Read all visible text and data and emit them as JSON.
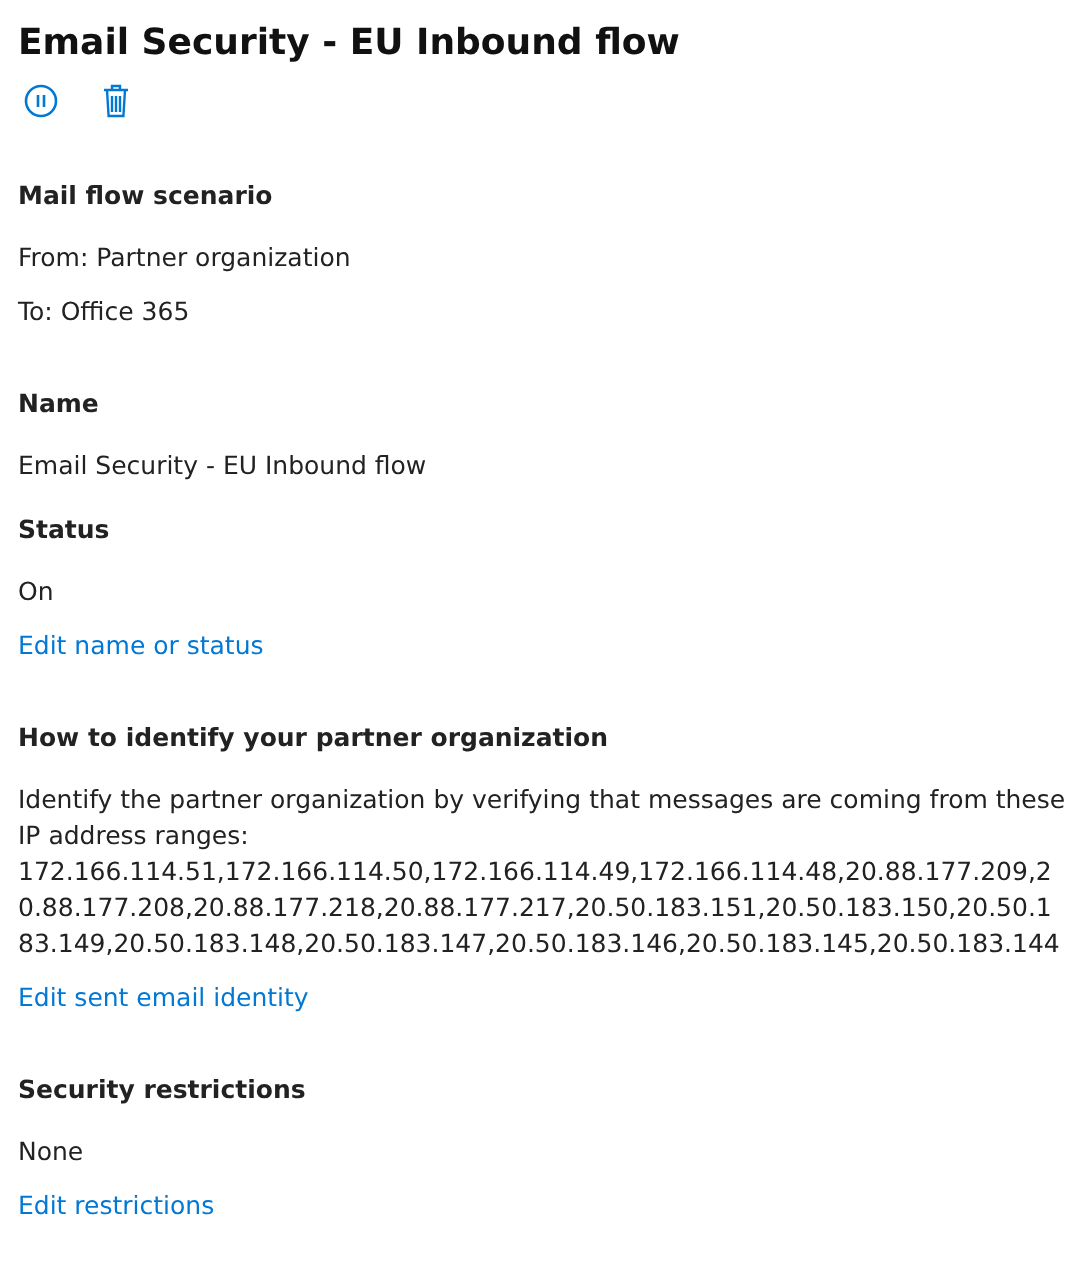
{
  "title": "Email Security - EU Inbound flow",
  "actions": [
    {
      "kind": "pause"
    },
    {
      "kind": "delete"
    }
  ],
  "groups": [
    {
      "sections": [
        {
          "heading": "Mail flow scenario",
          "lines": [
            {
              "kind": "text",
              "text": "From: Partner organization"
            },
            {
              "kind": "text",
              "text": "To: Office 365"
            }
          ]
        }
      ]
    },
    {
      "sections": [
        {
          "heading": "Name",
          "lines": [
            {
              "kind": "text",
              "text": "Email Security - EU Inbound flow"
            }
          ]
        },
        {
          "heading": "Status",
          "lines": [
            {
              "kind": "text",
              "text": "On"
            },
            {
              "kind": "link",
              "text": "Edit name or status"
            }
          ]
        }
      ]
    },
    {
      "sections": [
        {
          "heading": "How to identify your partner organization",
          "lines": [
            {
              "kind": "paragraph",
              "text": "Identify the partner organization by verifying that messages are coming from these IP address ranges:"
            },
            {
              "kind": "ips",
              "text": "172.166.114.51,172.166.114.50,172.166.114.49,172.166.114.48,20.88.177.209,20.88.177.208,20.88.177.218,20.88.177.217,20.50.183.151,20.50.183.150,20.50.183.149,20.50.183.148,20.50.183.147,20.50.183.146,20.50.183.145,20.50.183.144"
            },
            {
              "kind": "link",
              "text": "Edit sent email identity"
            }
          ]
        }
      ]
    },
    {
      "sections": [
        {
          "heading": "Security restrictions",
          "lines": [
            {
              "kind": "text",
              "text": "None"
            },
            {
              "kind": "link",
              "text": "Edit restrictions"
            }
          ]
        }
      ]
    }
  ]
}
